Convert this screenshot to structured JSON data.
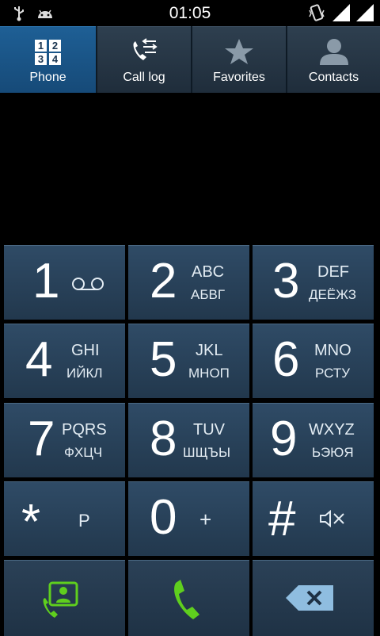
{
  "status_bar": {
    "time": "01:05",
    "left_icons": [
      "usb-icon",
      "android-icon"
    ],
    "right_icons": [
      "vibrate-icon",
      "signal-icon",
      "signal-icon"
    ]
  },
  "tabs": [
    {
      "label": "Phone",
      "icon": "dialpad-icon",
      "active": true
    },
    {
      "label": "Call log",
      "icon": "call-log-icon",
      "active": false
    },
    {
      "label": "Favorites",
      "icon": "star-icon",
      "active": false
    },
    {
      "label": "Contacts",
      "icon": "contact-icon",
      "active": false
    }
  ],
  "keypad": [
    {
      "digit": "1",
      "line1": "",
      "line2": "",
      "extra": "voicemail-icon"
    },
    {
      "digit": "2",
      "line1": "ABC",
      "line2": "АБВГ"
    },
    {
      "digit": "3",
      "line1": "DEF",
      "line2": "ДЕЁЖЗ"
    },
    {
      "digit": "4",
      "line1": "GHI",
      "line2": "ИЙКЛ"
    },
    {
      "digit": "5",
      "line1": "JKL",
      "line2": "МНОП"
    },
    {
      "digit": "6",
      "line1": "MNO",
      "line2": "РСТУ"
    },
    {
      "digit": "7",
      "line1": "PQRS",
      "line2": "ФХЦЧ"
    },
    {
      "digit": "8",
      "line1": "TUV",
      "line2": "ШЩЪЫ"
    },
    {
      "digit": "9",
      "line1": "WXYZ",
      "line2": "ЬЭЮЯ"
    },
    {
      "digit": "*",
      "sym": "P"
    },
    {
      "digit": "0",
      "sym": "+"
    },
    {
      "digit": "#",
      "extra": "mute-icon"
    }
  ],
  "bottom_buttons": [
    {
      "name": "contacts-add",
      "icon": "add-contact-icon"
    },
    {
      "name": "call",
      "icon": "phone-call-icon",
      "color": "#5fcf1e"
    },
    {
      "name": "backspace",
      "icon": "backspace-icon"
    }
  ],
  "colors": {
    "active_tab": "#1a5687",
    "key_bg": "#2a4660",
    "call_green": "#5fcf1e"
  }
}
